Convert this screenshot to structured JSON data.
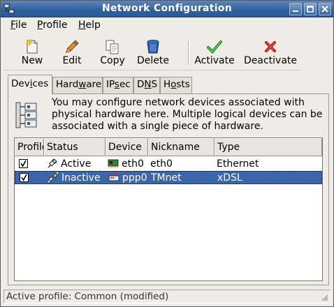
{
  "window": {
    "title": "Network Configuration"
  },
  "menu": {
    "file": {
      "pre": "",
      "key": "F",
      "post": "ile"
    },
    "profile": {
      "pre": "",
      "key": "P",
      "post": "rofile"
    },
    "help": {
      "pre": "",
      "key": "H",
      "post": "elp"
    }
  },
  "toolbar": {
    "new_label": "New",
    "edit_label": "Edit",
    "copy_label": "Copy",
    "delete_label": "Delete",
    "activate_label": "Activate",
    "deactivate_label": "Deactivate"
  },
  "tabs": [
    {
      "pre": "Dev",
      "key": "i",
      "post": "ces"
    },
    {
      "pre": "Hard",
      "key": "w",
      "post": "are"
    },
    {
      "pre": "IP",
      "key": "s",
      "post": "ec"
    },
    {
      "pre": "D",
      "key": "N",
      "post": "S"
    },
    {
      "pre": "H",
      "key": "o",
      "post": "sts"
    }
  ],
  "devices": {
    "info_text": "You may configure network devices associated with physical hardware here.  Multiple logical devices can be associated with a single piece of hardware.",
    "columns": [
      "Profile",
      "Status",
      "Device",
      "Nickname",
      "Type"
    ],
    "rows": [
      {
        "profile": true,
        "status": "Active",
        "device": "eth0",
        "nickname": "eth0",
        "type": "Ethernet",
        "selected": false
      },
      {
        "profile": true,
        "status": "Inactive",
        "device": "ppp0",
        "nickname": "TMnet",
        "type": "xDSL",
        "selected": true
      }
    ]
  },
  "statusbar": {
    "text": "Active profile: Common (modified)"
  },
  "colors": {
    "titlebar": "#2f5f9c",
    "selection": "#3b66ab",
    "window_bg": "#efebe7"
  }
}
